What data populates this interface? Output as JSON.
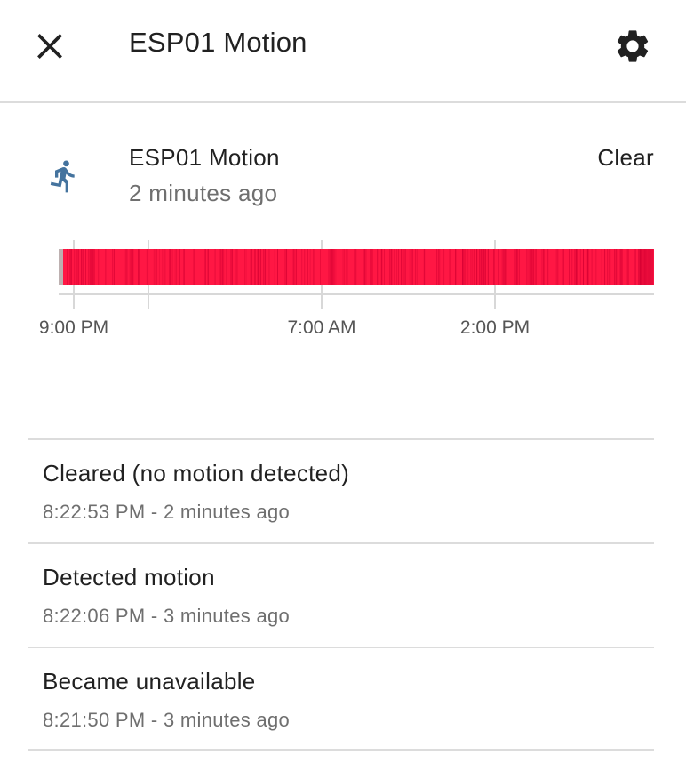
{
  "header": {
    "title": "ESP01 Motion",
    "close_icon": "close-icon",
    "settings_icon": "gear-icon"
  },
  "entity": {
    "name": "ESP01 Motion",
    "last_changed": "2 minutes ago",
    "state": "Clear",
    "icon": "motion-sensor-walking-icon",
    "icon_color": "#44739e"
  },
  "history": {
    "tick_labels": [
      "9:00 PM",
      "7:00 AM",
      "2:00 PM"
    ],
    "colors": {
      "detected": "#ff1744",
      "detected_dark": "#d50032",
      "unavailable": "#bdb0b0",
      "gridline": "#d8d8d8"
    }
  },
  "events": [
    {
      "message": "Cleared (no motion detected)",
      "time": "8:22:53 PM - 2 minutes ago"
    },
    {
      "message": "Detected motion",
      "time": "8:22:06 PM - 3 minutes ago"
    },
    {
      "message": "Became unavailable",
      "time": "8:21:50 PM - 3 minutes ago"
    }
  ]
}
